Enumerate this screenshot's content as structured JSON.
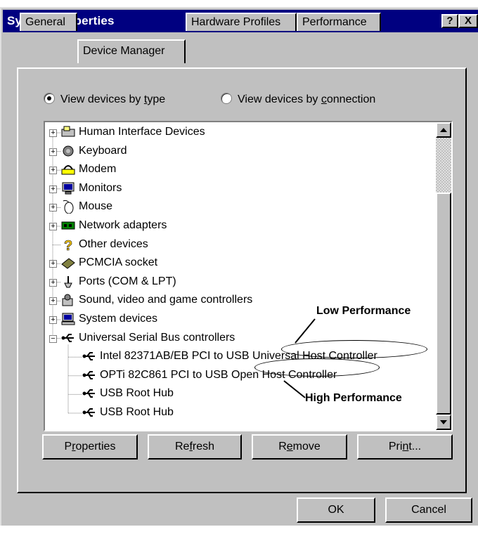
{
  "window": {
    "title": "System Properties",
    "help_glyph": "?",
    "close_glyph": "X"
  },
  "tabs": [
    {
      "label": "General",
      "active": false
    },
    {
      "label": "Device Manager",
      "active": true
    },
    {
      "label": "Hardware Profiles",
      "active": false
    },
    {
      "label": "Performance",
      "active": false
    }
  ],
  "view_options": {
    "by_type": {
      "pre": "View devices by ",
      "key": "t",
      "post": "ype",
      "selected": true
    },
    "by_connection": {
      "pre": "View devices by ",
      "key": "c",
      "post": "onnection",
      "selected": false
    }
  },
  "devices": [
    {
      "label": "Human Interface Devices",
      "icon": "hid-icon",
      "expandable": true,
      "indent": 0
    },
    {
      "label": "Keyboard",
      "icon": "keyboard-icon",
      "expandable": true,
      "indent": 0
    },
    {
      "label": "Modem",
      "icon": "modem-icon",
      "expandable": true,
      "indent": 0
    },
    {
      "label": "Monitors",
      "icon": "monitor-icon",
      "expandable": true,
      "indent": 0
    },
    {
      "label": "Mouse",
      "icon": "mouse-icon",
      "expandable": true,
      "indent": 0
    },
    {
      "label": "Network adapters",
      "icon": "network-adapter-icon",
      "expandable": true,
      "indent": 0
    },
    {
      "label": "Other devices",
      "icon": "question-mark-icon",
      "expandable": false,
      "indent": 0
    },
    {
      "label": "PCMCIA socket",
      "icon": "pcmcia-icon",
      "expandable": true,
      "indent": 0
    },
    {
      "label": "Ports (COM & LPT)",
      "icon": "port-icon",
      "expandable": true,
      "indent": 0
    },
    {
      "label": "Sound, video and game controllers",
      "icon": "sound-icon",
      "expandable": true,
      "indent": 0
    },
    {
      "label": "System devices",
      "icon": "system-devices-icon",
      "expandable": true,
      "indent": 0
    },
    {
      "label": "Universal Serial Bus controllers",
      "icon": "usb-icon",
      "expandable": true,
      "expanded": true,
      "indent": 0
    },
    {
      "label": "Intel 82371AB/EB PCI to USB Universal Host Controller",
      "icon": "usb-icon",
      "expandable": false,
      "indent": 1
    },
    {
      "label": "OPTi 82C861 PCI to USB Open Host Controller",
      "icon": "usb-icon",
      "expandable": false,
      "indent": 1
    },
    {
      "label": "USB Root Hub",
      "icon": "usb-icon",
      "expandable": false,
      "indent": 1
    },
    {
      "label": "USB Root Hub",
      "icon": "usb-icon",
      "expandable": false,
      "indent": 1
    }
  ],
  "annotations": {
    "low": "Low Performance",
    "high": "High Performance"
  },
  "buttons": {
    "properties": {
      "pre": "P",
      "key": "r",
      "post": "operties"
    },
    "refresh": {
      "pre": "Re",
      "key": "f",
      "post": "resh"
    },
    "remove": {
      "pre": "R",
      "key": "e",
      "post": "move"
    },
    "print": {
      "pre": "Pri",
      "key": "n",
      "post": "t..."
    },
    "ok": "OK",
    "cancel": "Cancel"
  }
}
